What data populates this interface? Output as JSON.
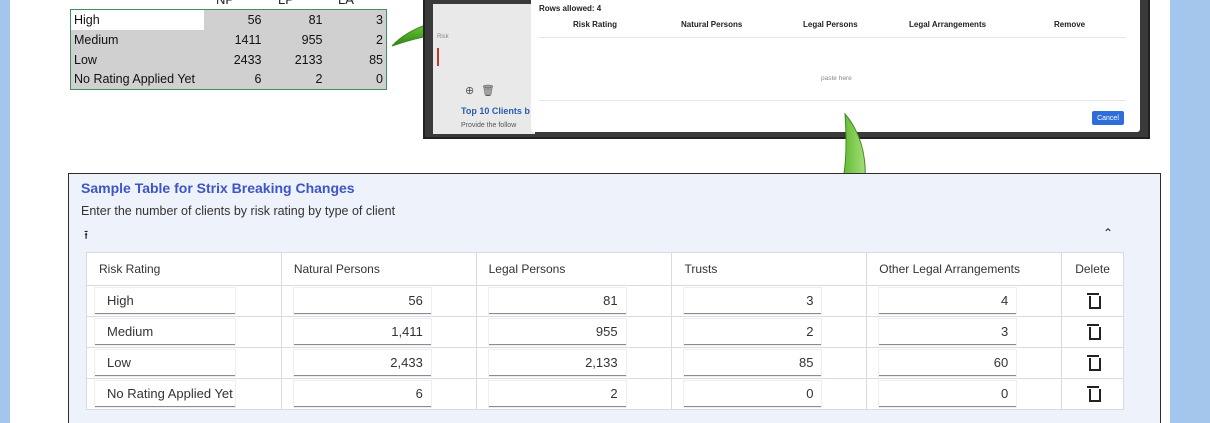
{
  "excel": {
    "headers": [
      "NP",
      "LP",
      "LA"
    ],
    "rows": [
      {
        "label": "High",
        "np": "56",
        "lp": "81",
        "la": "3"
      },
      {
        "label": "Medium",
        "np": "1411",
        "lp": "955",
        "la": "2"
      },
      {
        "label": "Low",
        "np": "2433",
        "lp": "2133",
        "la": "85"
      },
      {
        "label": "No Rating Applied Yet",
        "np": "6",
        "lp": "2",
        "la": "0"
      }
    ]
  },
  "dialog": {
    "rows_allowed": "Rows allowed: 4",
    "columns": [
      "Risk Rating",
      "Natural Persons",
      "Legal Persons",
      "Legal Arrangements",
      "Remove"
    ],
    "paste_hint": "paste here",
    "cancel_label": "Cancel",
    "side_risk_label": "Risk",
    "side_top10": "Top 10 Clients b",
    "side_provide": "Provide the follow"
  },
  "section": {
    "title": "Sample Table for Strix Breaking Changes",
    "description": "Enter the number of clients by risk rating by type of client",
    "upload_icon": "upload-icon",
    "collapse_icon": "chevron-up-icon"
  },
  "table": {
    "columns": [
      "Risk Rating",
      "Natural Persons",
      "Legal Persons",
      "Trusts",
      "Other Legal Arrangements",
      "Delete"
    ],
    "rows": [
      {
        "rating": "High",
        "np": "56",
        "lp": "81",
        "trusts": "3",
        "ola": "4"
      },
      {
        "rating": "Medium",
        "np": "1,411",
        "lp": "955",
        "trusts": "2",
        "ola": "3"
      },
      {
        "rating": "Low",
        "np": "2,433",
        "lp": "2,133",
        "trusts": "85",
        "ola": "60"
      },
      {
        "rating": "No Rating Applied Yet",
        "np": "6",
        "lp": "2",
        "trusts": "0",
        "ola": "0"
      }
    ]
  },
  "colors": {
    "background": "#a4c6ec",
    "title_blue": "#3e55c5",
    "excel_border": "#3f8f5f",
    "arrow_green": "#5cb82e",
    "cancel_blue": "#2f6ed8"
  }
}
